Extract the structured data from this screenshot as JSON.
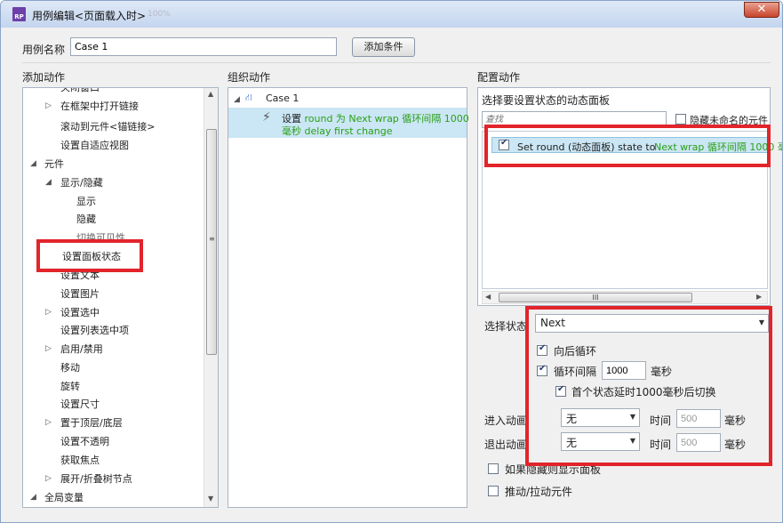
{
  "window": {
    "title": "用例编辑<页面载入时>",
    "ghost_text": "100%",
    "close_glyph": "✕"
  },
  "case_name": {
    "label": "用例名称",
    "value": "Case 1"
  },
  "add_condition_button": "添加条件",
  "sections": {
    "add_action": "添加动作",
    "organize_action": "组织动作",
    "configure_action": "配置动作"
  },
  "action_tree": [
    {
      "label": "关闭窗口"
    },
    {
      "label": "在框架中打开链接"
    },
    {
      "label": "滚动到元件<锚链接>"
    },
    {
      "label": "设置自适应视图"
    },
    {
      "label": "元件"
    },
    {
      "label": "显示/隐藏"
    },
    {
      "label": "显示"
    },
    {
      "label": "隐藏"
    },
    {
      "label": "切换可见性"
    },
    {
      "label": "设置面板状态"
    },
    {
      "label": "设置文本"
    },
    {
      "label": "设置图片"
    },
    {
      "label": "设置选中"
    },
    {
      "label": "设置列表选中项"
    },
    {
      "label": "启用/禁用"
    },
    {
      "label": "移动"
    },
    {
      "label": "旋转"
    },
    {
      "label": "设置尺寸"
    },
    {
      "label": "置于顶层/底层"
    },
    {
      "label": "设置不透明"
    },
    {
      "label": "获取焦点"
    },
    {
      "label": "展开/折叠树节点"
    },
    {
      "label": "全局变量"
    }
  ],
  "organize": {
    "case_label": "Case 1",
    "action": {
      "prefix": "设置",
      "target": "round 为 Next wrap 循环间隔 1000",
      "line2": "毫秒 delay first change"
    }
  },
  "configure": {
    "select_panel_label": "选择要设置状态的动态面板",
    "search_placeholder": "查找",
    "hide_unnamed_label": "隐藏未命名的元件",
    "panel_item": {
      "prefix": "Set round (动态面板) state to",
      "value": "Next wrap 循环间隔 1000 毫"
    },
    "scroll_mid_glyph": "III",
    "select_state_label": "选择状态",
    "state_value": "Next",
    "wrap_label": "向后循环",
    "loop_interval_label": "循环间隔",
    "loop_interval_value": "1000",
    "ms_unit": "毫秒",
    "first_delay_label": "首个状态延时1000毫秒后切换",
    "enter_anim_label": "进入动画",
    "exit_anim_label": "退出动画",
    "anim_value": "无",
    "time_label": "时间",
    "time_value": "500",
    "time_unit": "毫秒",
    "show_if_hidden_label": "如果隐藏则显示面板",
    "push_pull_label": "推动/拉动元件"
  }
}
